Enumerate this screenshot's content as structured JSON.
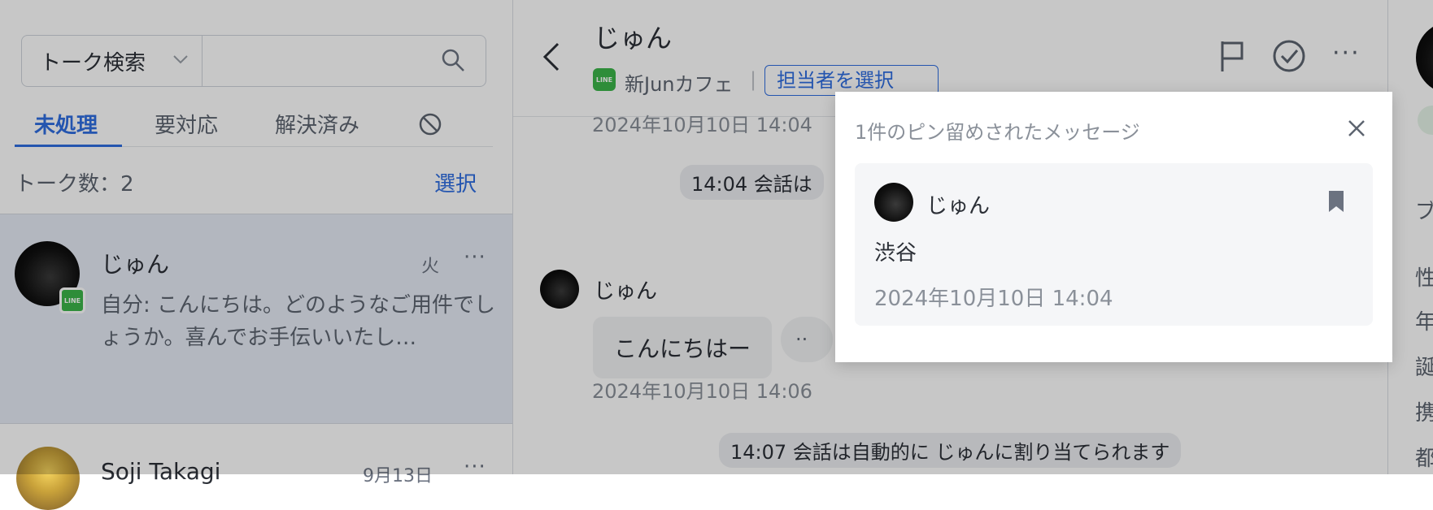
{
  "left": {
    "search_select": "トーク検索",
    "tabs": [
      "未処理",
      "要対応",
      "解決済み"
    ],
    "count": "トーク数：2",
    "select_label": "選択",
    "conversations": [
      {
        "name": "じゅん",
        "time": "火",
        "preview": "自分: こんにちは。どのようなご用件でしょうか。喜んでお手伝いいたし…",
        "channel": "LINE"
      },
      {
        "name": "Soji Takagi",
        "time": "9月13日"
      }
    ]
  },
  "header": {
    "title": "じゅん",
    "channel_badge": "LINE",
    "account": "新Junカフェ",
    "separator": "|",
    "assignee": "担当者を選択"
  },
  "chat": {
    "ts_top": "2024年10月10日 14:04",
    "system1": "14:04 会話は",
    "sender": "じゅん",
    "message": "こんにちはー",
    "more_bubble": "··",
    "message_ts": "2024年10月10日 14:06",
    "system2": "14:07 会話は自動的に じゅんに割り当てられます"
  },
  "right_peek": [
    "ブ",
    "性",
    "年",
    "誕",
    "携",
    "都"
  ],
  "popup": {
    "title": "1件のピン留めされたメッセージ",
    "sender": "じゅん",
    "text": "渋谷",
    "timestamp": "2024年10月10日 14:04"
  },
  "colors": {
    "accent": "#2f6de1",
    "line_green": "#3bb54a"
  }
}
